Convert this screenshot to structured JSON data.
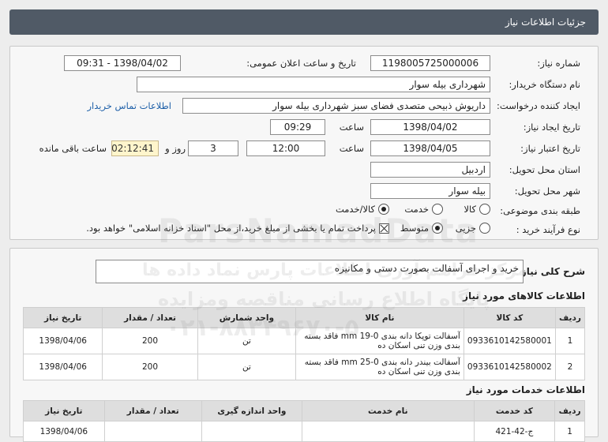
{
  "header": {
    "title": "جزئیات اطلاعات نیاز"
  },
  "form": {
    "need_number_label": "شماره نیاز:",
    "need_number": "1198005725000006",
    "announce_label": "تاریخ و ساعت اعلان عمومی:",
    "announce_value": "1398/04/02 - 09:31",
    "buyer_org_label": "نام دستگاه خریدار:",
    "buyer_org": "شهرداری بیله سوار",
    "requester_label": "ایجاد کننده درخواست:",
    "requester": "داریوش ذبیحی متصدی فضای سبز شهرداری بیله سوار",
    "contact_link": "اطلاعات تماس خریدار",
    "created_label": "تاریخ ایجاد نیاز:",
    "created_date": "1398/04/02",
    "created_time_label": "ساعت",
    "created_time": "09:29",
    "validity_label": "تاریخ اعتبار نیاز:",
    "validity_date": "1398/04/05",
    "validity_time_label": "ساعت",
    "validity_time": "12:00",
    "days_value": "3",
    "days_label": "روز و",
    "remaining_time": "02:12:41",
    "remaining_label": "ساعت باقی مانده",
    "province_label": "استان محل تحویل:",
    "province": "اردبیل",
    "city_label": "شهر محل تحویل:",
    "city": "بیله سوار",
    "category_label": "طبقه بندی موضوعی:",
    "category_options": [
      "کالا",
      "خدمت",
      "کالا/خدمت"
    ],
    "category_selected": 2,
    "process_label": "نوع فرآیند خرید :",
    "process_options": [
      "جزیی",
      "متوسط"
    ],
    "process_selected": 1,
    "payment_note": "پرداخت تمام یا بخشی از مبلغ خرید،از محل \"اسناد خزانه اسلامی\" خواهد بود."
  },
  "description": {
    "label": "شرح کلی نیاز:",
    "text": "خرید و اجرای آسفالت بصورت دستی و مکانیزه"
  },
  "goods": {
    "title": "اطلاعات کالاهای مورد نیاز",
    "headers": [
      "ردیف",
      "کد کالا",
      "نام کالا",
      "واحد شمارش",
      "تعداد / مقدار",
      "تاریخ نیاز"
    ],
    "rows": [
      [
        "1",
        "0933610142580001",
        "آسفالت توپکا دانه بندی mm 19-0 فاقد بسته بندی وزن تنی اسکان ده",
        "تن",
        "200",
        "1398/04/06"
      ],
      [
        "2",
        "0933610142580002",
        "آسفالت بیندر دانه بندی mm 25-0 فاقد بسته بندی وزن تنی اسکان ده",
        "تن",
        "200",
        "1398/04/06"
      ]
    ]
  },
  "services": {
    "title": "اطلاعات خدمات مورد نیاز",
    "headers": [
      "ردیف",
      "کد خدمت",
      "نام خدمت",
      "واحد اندازه گیری",
      "تعداد / مقدار",
      "تاریخ نیاز"
    ],
    "rows": [
      [
        "1",
        "ج-42-421",
        "",
        "",
        "",
        "1398/04/06"
      ]
    ]
  },
  "watermarks": {
    "site": "ParsNamadData",
    "fa1": "مرکز فراهم آوری اطلاعات پارس نماد داده ها",
    "fa2": "پایگاه اطلاع رسانی مناقصه ومزایده",
    "phone": "۰۲۱-۸۸۳۴۹۶۷۰-۵"
  }
}
